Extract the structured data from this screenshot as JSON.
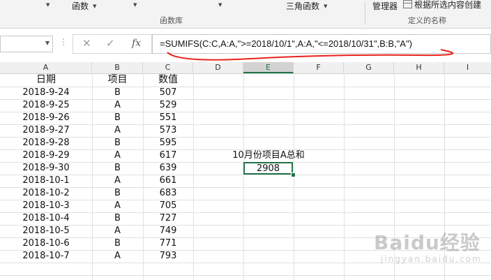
{
  "ribbon": {
    "functions_label": "函数",
    "trig_label": "三角函数",
    "library_group": "函数库",
    "manager_label": "管理器",
    "create_from_selection": "根据所选内容创建",
    "defined_names_group": "定义的名称"
  },
  "formula_bar": {
    "name_box": "",
    "cancel_icon": "close-icon",
    "enter_icon": "check-icon",
    "fx_label": "fx",
    "formula": "=SUMIFS(C:C,A:A,\">=2018/10/1\",A:A,\"<=2018/10/31\",B:B,\"A\")",
    "annotation_color": "#e8231a"
  },
  "columns": [
    "A",
    "B",
    "C",
    "D",
    "E",
    "F",
    "G",
    "H",
    "I"
  ],
  "selected_column": "E",
  "table": {
    "headers": [
      "日期",
      "项目",
      "数值"
    ],
    "rows": [
      [
        "2018-9-24",
        "B",
        "507"
      ],
      [
        "2018-9-25",
        "A",
        "529"
      ],
      [
        "2018-9-26",
        "B",
        "551"
      ],
      [
        "2018-9-27",
        "A",
        "573"
      ],
      [
        "2018-9-28",
        "B",
        "595"
      ],
      [
        "2018-9-29",
        "A",
        "617"
      ],
      [
        "2018-9-30",
        "B",
        "639"
      ],
      [
        "2018-10-1",
        "A",
        "661"
      ],
      [
        "2018-10-2",
        "B",
        "683"
      ],
      [
        "2018-10-3",
        "A",
        "705"
      ],
      [
        "2018-10-4",
        "B",
        "727"
      ],
      [
        "2018-10-5",
        "A",
        "749"
      ],
      [
        "2018-10-6",
        "B",
        "771"
      ],
      [
        "2018-10-7",
        "A",
        "793"
      ]
    ]
  },
  "summary": {
    "label": "10月份项目A总和",
    "value": "2908"
  },
  "accent_color": "#217346",
  "watermark": {
    "brand": "Baidu经验",
    "site": "jingyan.baidu.com"
  }
}
